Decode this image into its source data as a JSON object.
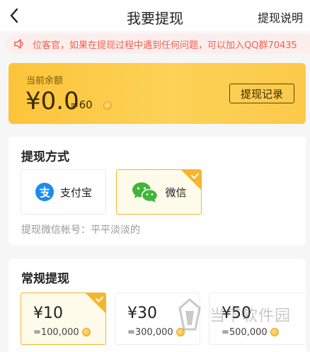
{
  "header": {
    "title": "我要提现",
    "help_label": "提现说明"
  },
  "notice": {
    "text": "位客官，如果在提现过程中遇到任何问题，可以加入QQ群70435"
  },
  "balance": {
    "label": "当前余额",
    "amount": "¥0.0",
    "coins": "=60",
    "records_label": "提现记录"
  },
  "method": {
    "title": "提现方式",
    "options": [
      {
        "label": "支付宝",
        "icon": "alipay-icon",
        "selected": false
      },
      {
        "label": "微信",
        "icon": "wechat-icon",
        "selected": true
      }
    ],
    "account_text": "提现微信帐号：平平淡淡的"
  },
  "normal": {
    "title": "常规提现",
    "amounts": [
      {
        "value": "¥10",
        "coins": "=100,000",
        "selected": true
      },
      {
        "value": "¥30",
        "coins": "=300,000",
        "selected": false
      },
      {
        "value": "¥50",
        "coins": "=500,000",
        "selected": false
      }
    ]
  },
  "watermark": {
    "text": "当下软件园"
  },
  "colors": {
    "accent": "#f5b52e",
    "notice_text": "#f0624f",
    "alipay": "#1a8cf0",
    "wechat": "#3fb53b"
  }
}
